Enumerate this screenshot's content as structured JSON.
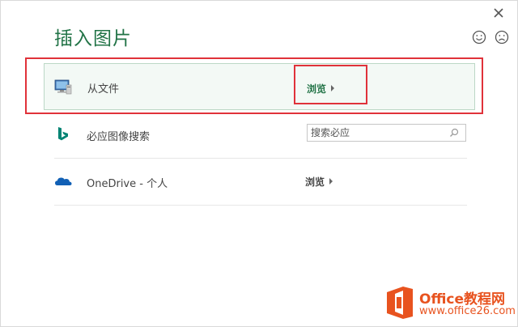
{
  "dialog": {
    "title": "插入图片"
  },
  "rows": [
    {
      "label": "从文件",
      "action": "浏览",
      "icon": "computer-icon"
    },
    {
      "label": "必应图像搜索",
      "search_placeholder": "搜索必应",
      "icon": "bing-icon"
    },
    {
      "label": "OneDrive - 个人",
      "action": "浏览",
      "icon": "onedrive-cloud-icon"
    }
  ],
  "watermark": {
    "line1": "Office教程网",
    "line2": "www.office26.com"
  },
  "colors": {
    "accent": "#217346",
    "highlight": "#e0323a",
    "watermark": "#e8531f"
  }
}
